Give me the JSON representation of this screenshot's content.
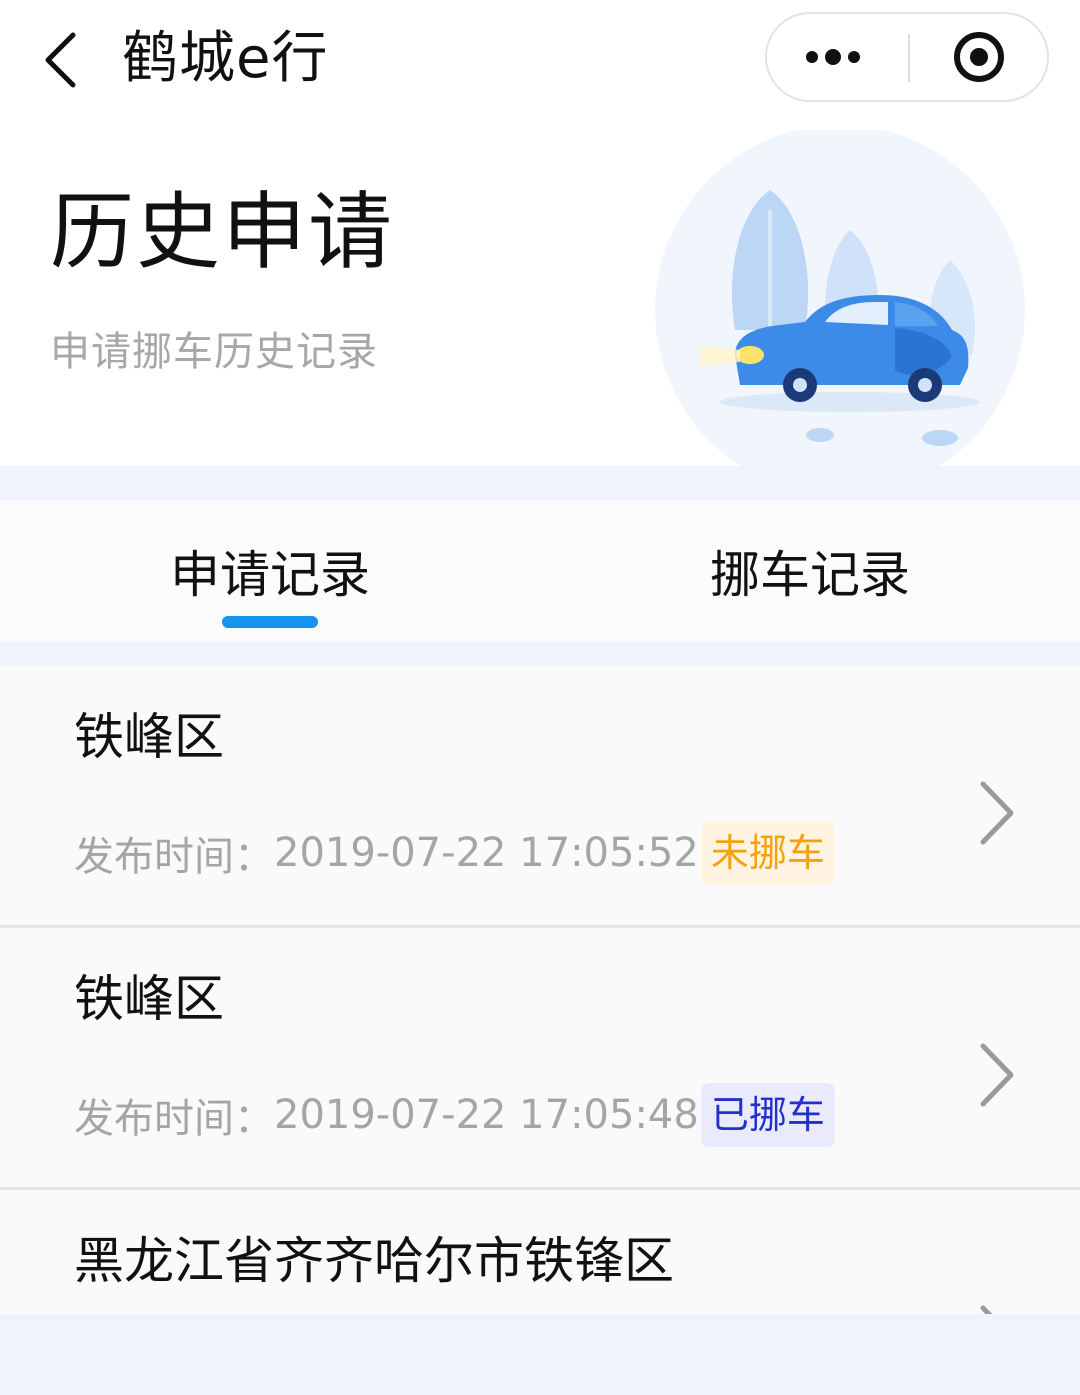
{
  "nav": {
    "title": "鹤城e行"
  },
  "header": {
    "title": "历史申请",
    "subtitle": "申请挪车历史记录"
  },
  "tabs": [
    {
      "label": "申请记录",
      "active": true
    },
    {
      "label": "挪车记录",
      "active": false
    }
  ],
  "records": [
    {
      "location": "铁峰区",
      "time_label": "发布时间：",
      "time": "2019-07-22 17:05:52",
      "status": "未挪车",
      "status_color": "#f5a20a"
    },
    {
      "location": "铁峰区",
      "time_label": "发布时间：",
      "time": "2019-07-22 17:05:48",
      "status": "已挪车",
      "status_color": "#2330cc"
    },
    {
      "location": "黑龙江省齐齐哈尔市铁锋区"
    }
  ],
  "colors": {
    "accent": "#1593ef",
    "page_bg": "#eef3fc"
  }
}
